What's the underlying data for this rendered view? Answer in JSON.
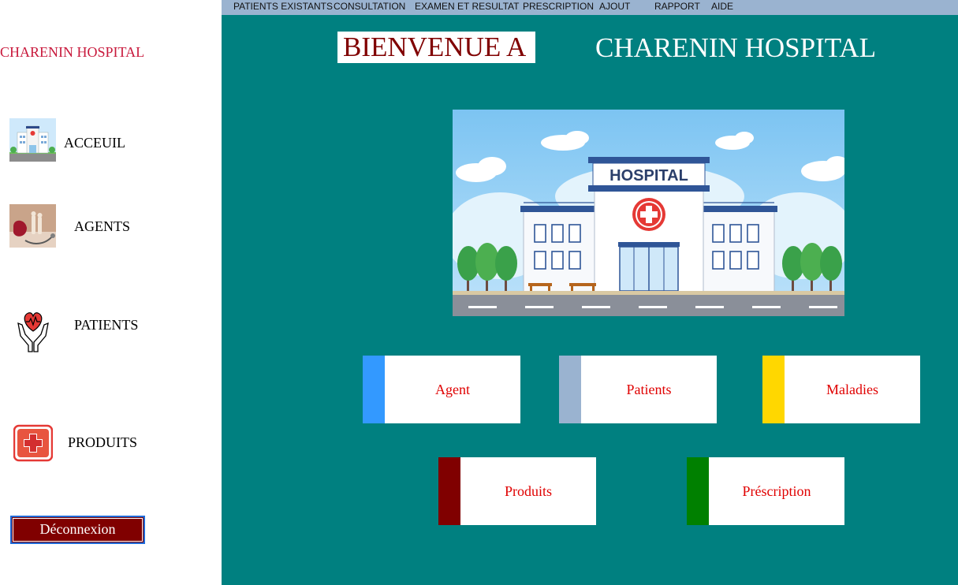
{
  "sidebar": {
    "brand": "CHARENIN HOSPITAL",
    "items": [
      {
        "label": "ACCEUIL",
        "icon": "hospital-building-icon"
      },
      {
        "label": "AGENTS",
        "icon": "stethoscope-photo-icon"
      },
      {
        "label": "PATIENTS",
        "icon": "heart-hands-icon"
      },
      {
        "label": "PRODUITS",
        "icon": "first-aid-kit-icon"
      }
    ],
    "logout_label": "Déconnexion"
  },
  "menubar": {
    "items": [
      "PATIENTS EXISTANTS",
      "CONSULTATION",
      "EXAMEN ET RESULTAT",
      "PRESCRIPTION",
      "AJOUT",
      "RAPPORT",
      "AIDE"
    ]
  },
  "header": {
    "welcome": "BIENVENUE A",
    "hospital_name": "CHARENIN HOSPITAL"
  },
  "illustration": {
    "sign_text": "HOSPITAL"
  },
  "cards": [
    {
      "label": "Agent",
      "color": "#3399ff"
    },
    {
      "label": "Patients",
      "color": "#9ab3d0"
    },
    {
      "label": "Maladies",
      "color": "#ffd700"
    },
    {
      "label": "Produits",
      "color": "#800000"
    },
    {
      "label": "Préscription",
      "color": "#008000"
    }
  ],
  "colors": {
    "main_background": "#008080",
    "menubar": "#9ab3d0",
    "brand": "#c8193c",
    "card_text": "#e00000",
    "logout": "#800000"
  }
}
